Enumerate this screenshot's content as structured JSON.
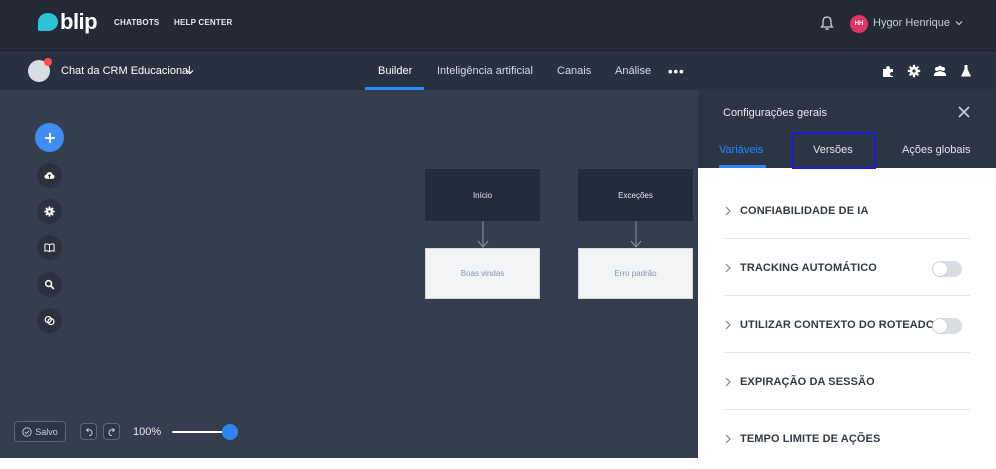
{
  "topbar": {
    "logo_text": "blip",
    "nav": [
      "CHATBOTS",
      "HELP CENTER"
    ],
    "user": {
      "initials": "HH",
      "name": "Hygor Henrique"
    }
  },
  "subbar": {
    "bot_name": "Chat da CRM Educacional",
    "tabs": [
      "Builder",
      "Inteligência artificial",
      "Canais",
      "Análise"
    ],
    "active_tab": "Builder",
    "more_label": "•••"
  },
  "canvas": {
    "blocks": [
      {
        "title": "Início",
        "child": "Boas vindas"
      },
      {
        "title": "Exceções",
        "child": "Erro padrão"
      }
    ],
    "tools": [
      "add-icon",
      "cloud-upload-icon",
      "gear-icon",
      "book-icon",
      "search-icon",
      "link-icon"
    ],
    "save_label": "Salvo",
    "zoom_label": "100%",
    "zoom_level_percent": 100
  },
  "panel": {
    "title": "Configurações gerais",
    "tabs": [
      "Variáveis",
      "Versões",
      "Ações globais"
    ],
    "active_tab": "Variáveis",
    "items": [
      {
        "label": "CONFIABILIDADE DE IA",
        "toggle": false
      },
      {
        "label": "TRACKING AUTOMÁTICO",
        "toggle": true
      },
      {
        "label": "UTILIZAR CONTEXTO DO ROTEADOR",
        "toggle": true
      },
      {
        "label": "EXPIRAÇÃO DA SESSÃO",
        "toggle": false
      },
      {
        "label": "TEMPO LIMITE DE AÇÕES",
        "toggle": false
      }
    ]
  },
  "colors": {
    "topbar_bg": "#232a36",
    "canvas_bg": "#353e4f",
    "accent": "#2f86f3",
    "brand": "#2cc3d5",
    "avatar": "#e0356b"
  }
}
